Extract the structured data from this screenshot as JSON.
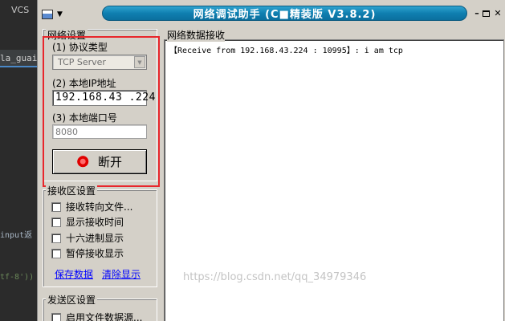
{
  "ide": {
    "vcs_label": "VCS",
    "tab_label": "la_guai.",
    "code_line1": "input返",
    "code_line2": "tf-8'))"
  },
  "window": {
    "title": "网络调试助手 (C■精装版 V3.8.2)",
    "controls": {
      "minimize": "–",
      "close": "✕"
    }
  },
  "net_settings": {
    "title": "网络设置",
    "protocol_label": "(1) 协议类型",
    "protocol_value": "TCP Server",
    "ip_label": "(2) 本地IP地址",
    "ip_value": "192.168.43 .224",
    "port_label": "(3) 本地端口号",
    "port_value": "8080",
    "disconnect_label": "断开",
    "led_color": "#e00000",
    "highlight_color": "#e8262b"
  },
  "recv_settings": {
    "title": "接收区设置",
    "options": [
      {
        "label": "接收转向文件..."
      },
      {
        "label": "显示接收时间"
      },
      {
        "label": "十六进制显示"
      },
      {
        "label": "暂停接收显示"
      }
    ],
    "save_link": "保存数据",
    "clear_link": "清除显示"
  },
  "send_settings": {
    "title": "发送区设置",
    "options": [
      {
        "label": "启用文件数据源..."
      }
    ]
  },
  "recv_panel": {
    "title": "网络数据接收",
    "content": "【Receive from 192.168.43.224 : 10995】: i am tcp"
  },
  "watermark": "https://blog.csdn.net/qq_34979346",
  "colors": {
    "title_bar": "#0f7fb0",
    "window_bg": "#d4d0c8",
    "link": "#0000ff"
  }
}
